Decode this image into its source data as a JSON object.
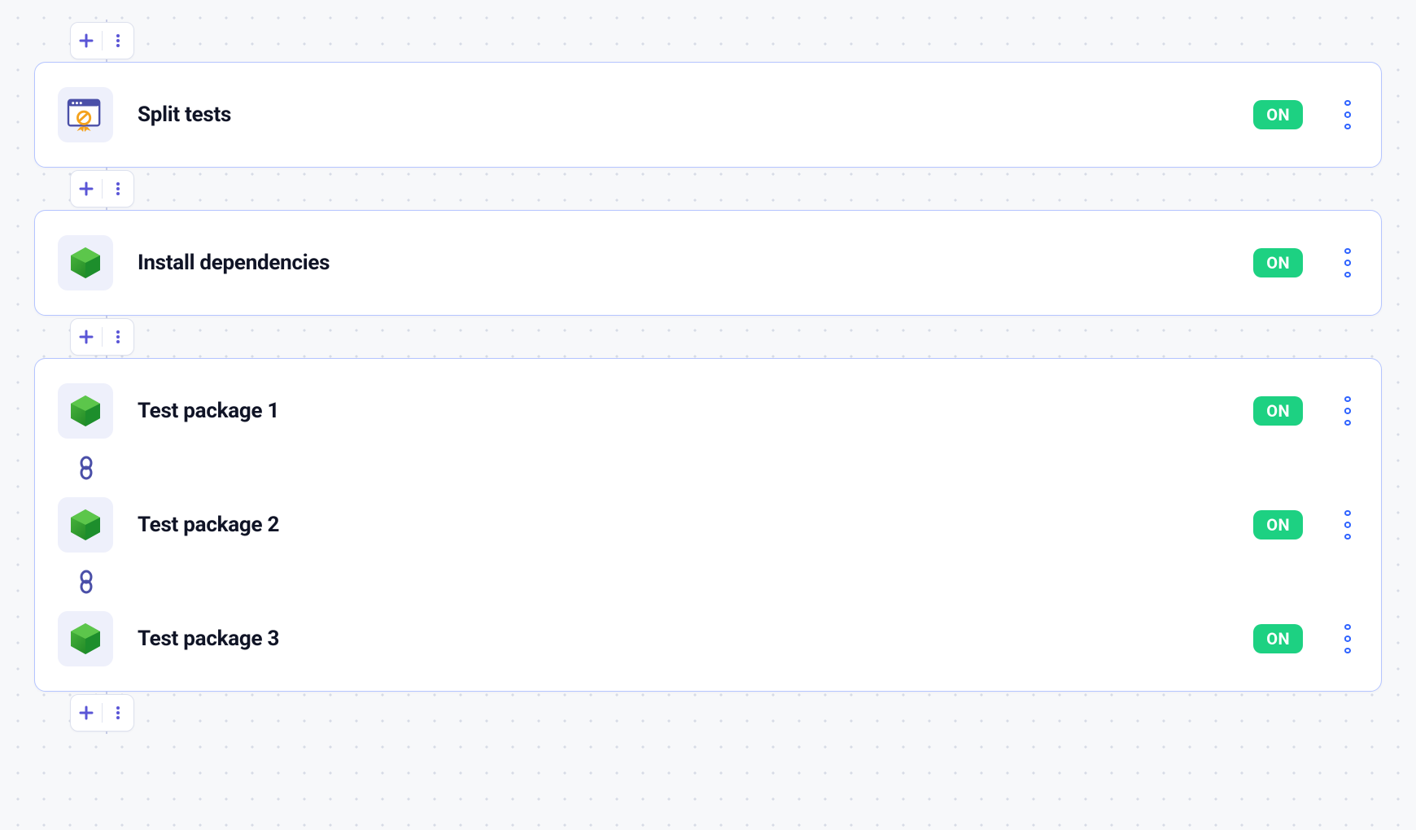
{
  "steps": [
    {
      "title": "Split tests",
      "badge": "ON",
      "icon": "window-test"
    },
    {
      "title": "Install dependencies",
      "badge": "ON",
      "icon": "hex-node"
    }
  ],
  "parallel_group": {
    "steps": [
      {
        "title": "Test package 1",
        "badge": "ON",
        "icon": "hex-node"
      },
      {
        "title": "Test package 2",
        "badge": "ON",
        "icon": "hex-node"
      },
      {
        "title": "Test package 3",
        "badge": "ON",
        "icon": "hex-node"
      }
    ]
  },
  "colors": {
    "card_border": "#b5c5ff",
    "badge_bg": "#1dd182",
    "icon_bg": "#eef0fb",
    "plus": "#5a55d6",
    "drag_dot": "#2f63ff"
  }
}
